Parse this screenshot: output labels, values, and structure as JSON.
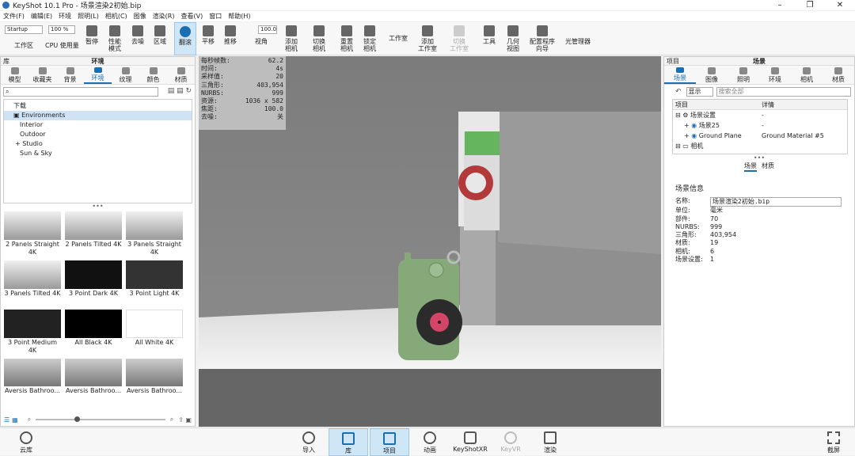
{
  "window": {
    "title": "KeyShot 10.1 Pro  - 场景渲染2初始.bip"
  },
  "menu": [
    "文件(F)",
    "编辑(E)",
    "环境",
    "照明(L)",
    "相机(C)",
    "图像",
    "渲染(R)",
    "查看(V)",
    "窗口",
    "帮助(H)"
  ],
  "toolbar": {
    "workspace_value": "Startup",
    "workspace_label": "工作区",
    "zoom_value": "100 %",
    "cpu_label": "CPU 使用量",
    "pause": "暂停",
    "perf": "性能\n模式",
    "denoise": "去噪",
    "region": "区域",
    "tumble": "翻滚",
    "pan": "平移",
    "dolly": "推移",
    "fov_value": "100.0",
    "view": "视角",
    "add_camera": "添加\n相机",
    "switch_camera": "切换\n相机",
    "reset_camera": "重置\n相机",
    "lock_camera": "锁定\n相机",
    "studio": "工作室",
    "add_studio": "添加\n工作室",
    "switch_studio": "切换\n工作室",
    "tools": "工具",
    "geometry_view": "几何\n视图",
    "config_wizard": "配置程序\n向导",
    "light_manager": "光管理器"
  },
  "library": {
    "panel_label": "库",
    "title": "环境",
    "tabs": [
      "模型",
      "收藏夹",
      "背景",
      "环境",
      "纹理",
      "颜色",
      "材质"
    ],
    "selected_tab": "环境",
    "tree": [
      {
        "label": "下载",
        "indent": 0
      },
      {
        "label": "Environments",
        "indent": 0,
        "selected": true
      },
      {
        "label": "Interior",
        "indent": 1
      },
      {
        "label": "Outdoor",
        "indent": 1
      },
      {
        "label": "Studio",
        "indent": 1
      },
      {
        "label": "Sun & Sky",
        "indent": 1
      }
    ],
    "thumbnails": [
      "2 Panels Straight 4K",
      "2 Panels Tilted 4K",
      "3 Panels Straight 4K",
      "3 Panels Tilted 4K",
      "3 Point Dark 4K",
      "3 Point Light 4K",
      "3 Point Medium 4K",
      "All Black 4K",
      "All White 4K",
      "Aversis Bathroo...",
      "Aversis Bathroo...",
      "Aversis Bathroo..."
    ]
  },
  "stats": [
    {
      "k": "每秒帧数:",
      "v": "62.2"
    },
    {
      "k": "时间:",
      "v": "4s"
    },
    {
      "k": "采样值:",
      "v": "20"
    },
    {
      "k": "三角形:",
      "v": "403,954"
    },
    {
      "k": "NURBS:",
      "v": "999"
    },
    {
      "k": "资源:",
      "v": "1036 x 582"
    },
    {
      "k": "焦距:",
      "v": "100.0"
    },
    {
      "k": "去噪:",
      "v": "关"
    }
  ],
  "project": {
    "panel_label": "项目",
    "title": "场景",
    "tabs": [
      "场景",
      "图像",
      "照明",
      "环境",
      "相机",
      "材质"
    ],
    "selected_tab": "场景",
    "show_label": "显示",
    "search_placeholder": "搜索全部",
    "col_item": "项目",
    "col_detail": "详情",
    "rows": [
      {
        "name": "场景设置",
        "detail": "-"
      },
      {
        "name": "场景25",
        "detail": "-"
      },
      {
        "name": "Ground Plane",
        "detail": "Ground Material #5"
      },
      {
        "name": "相机",
        "detail": ""
      }
    ],
    "subtabs": [
      "场景",
      "材质"
    ],
    "info_title": "场景信息",
    "info_name_label": "名称:",
    "info_name_value": "场景渲染2初始.bip",
    "info": [
      {
        "k": "单位:",
        "v": "毫米"
      },
      {
        "k": "部件:",
        "v": "70"
      },
      {
        "k": "NURBS:",
        "v": "999"
      },
      {
        "k": "三角形:",
        "v": "403,954"
      },
      {
        "k": "材质:",
        "v": "19"
      },
      {
        "k": "相机:",
        "v": "6"
      },
      {
        "k": "场景设置:",
        "v": "1"
      }
    ]
  },
  "bottom": {
    "cloud": "云库",
    "import": "导入",
    "library": "库",
    "project": "项目",
    "animation": "动画",
    "keyshotxr": "KeyShotXR",
    "keyvr": "KeyVR",
    "render": "渲染",
    "screenshot": "截屏"
  }
}
